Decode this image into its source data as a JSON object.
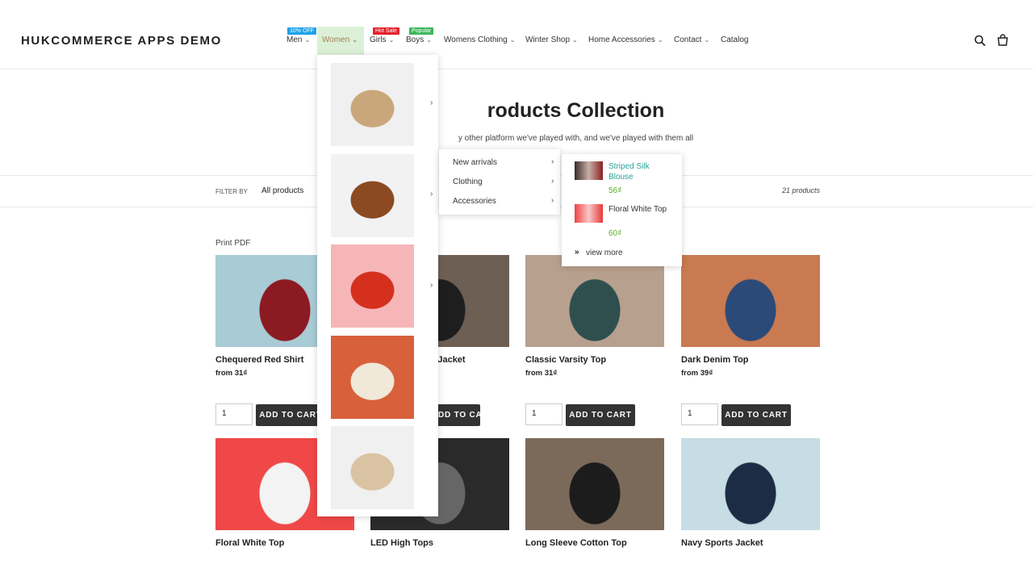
{
  "header": {
    "logo": "HUKCOMMERCE APPS DEMO",
    "nav": [
      {
        "label": "Men",
        "badge": "10% OFF",
        "badge_color": "#1ea1e8",
        "chev": true
      },
      {
        "label": "Women",
        "chev": true,
        "active": true,
        "color": "#a08050"
      },
      {
        "label": "Girls",
        "badge": "Hot Sale",
        "badge_color": "#e4202a",
        "chev": true
      },
      {
        "label": "Boys",
        "badge": "Popular",
        "badge_color": "#3cb55c",
        "chev": true
      },
      {
        "label": "Womens Clothing",
        "chev": true
      },
      {
        "label": "Winter Shop",
        "chev": true
      },
      {
        "label": "Home Accessories",
        "chev": true
      },
      {
        "label": "Contact",
        "chev": true
      },
      {
        "label": "Catalog",
        "chev": false
      }
    ],
    "icons": [
      "search-icon",
      "cart-icon"
    ]
  },
  "collection": {
    "title": "roducts Collection",
    "subtitle": "y other platform we've played with, and we've played with them all"
  },
  "filter": {
    "label": "FILTER BY",
    "value": "All products",
    "count": "21 products"
  },
  "print_pdf": "Print PDF",
  "cart_label": "ADD TO CART",
  "products": [
    {
      "name": "Chequered Red Shirt",
      "price": "from 31₫",
      "qty": "1",
      "colors": [
        "#a9cbd5",
        "#8c1a22"
      ]
    },
    {
      "name": "r Jacket",
      "price": "",
      "qty": "1",
      "colors": [
        "#6e5f55",
        "#1e1e1e"
      ]
    },
    {
      "name": "Classic Varsity Top",
      "price": "from 31₫",
      "qty": "1",
      "colors": [
        "#b8a08e",
        "#2f4f4f"
      ]
    },
    {
      "name": "Dark Denim Top",
      "price": "from 39₫",
      "qty": "1",
      "colors": [
        "#c97a50",
        "#2b4a78"
      ]
    },
    {
      "name": "Floral White Top",
      "colors": [
        "#f04848",
        "#f3f3f3"
      ]
    },
    {
      "name": "LED High Tops",
      "colors": [
        "#2a2a2a",
        "#666"
      ]
    },
    {
      "name": "Long Sleeve Cotton Top",
      "colors": [
        "#7b6a5a",
        "#1c1c1c"
      ]
    },
    {
      "name": "Navy Sports Jacket",
      "colors": [
        "#c7dde5",
        "#1c2c44"
      ]
    }
  ],
  "mega_menu": {
    "images": [
      {
        "name": "tan-crossbody-bag",
        "bg": "#f0f0f0",
        "fg": "#c9a77a"
      },
      {
        "name": "brown-leather-handbag",
        "bg": "#f2f2f2",
        "fg": "#8b4a22"
      },
      {
        "name": "red-bucket-bag",
        "bg": "#f6b6b8",
        "fg": "#d5301e"
      },
      {
        "name": "cream-backpack",
        "bg": "#d8603a",
        "fg": "#f0e8d8"
      },
      {
        "name": "sherpa-pouch",
        "bg": "#f0f0f0",
        "fg": "#d9c3a2"
      }
    ]
  },
  "submenu": {
    "items": [
      "New arrivals",
      "Clothing",
      "Accessories"
    ]
  },
  "flyout": {
    "products": [
      {
        "name": "Striped Silk Blouse",
        "price": "56₫",
        "name_color": "#2aa198"
      },
      {
        "name": "Floral White Top",
        "price": "60₫",
        "name_color": "#333"
      }
    ],
    "price_color": "#5aae2a",
    "view_more": "view more"
  }
}
